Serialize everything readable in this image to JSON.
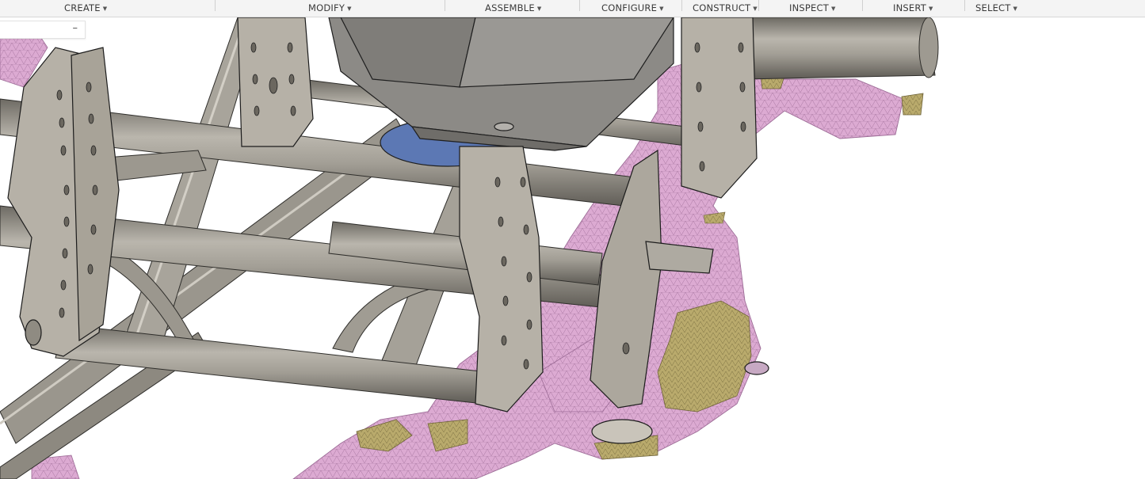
{
  "toolbar": {
    "menus": [
      {
        "label": "CREATE"
      },
      {
        "label": "MODIFY"
      },
      {
        "label": "ASSEMBLE"
      },
      {
        "label": "CONFIGURE"
      },
      {
        "label": "CONSTRUCT"
      },
      {
        "label": "INSPECT"
      },
      {
        "label": "INSERT"
      },
      {
        "label": "SELECT"
      }
    ]
  },
  "browser_panel": {
    "minimize_glyph": "–"
  },
  "colors": {
    "tube": "#8f8b82",
    "plate": "#b6b1a7",
    "mesh_pink": "#d9a8cf",
    "mesh_olive": "#b7a86a",
    "housing": "#8c8a86",
    "bearing_blue": "#5c78b4"
  }
}
